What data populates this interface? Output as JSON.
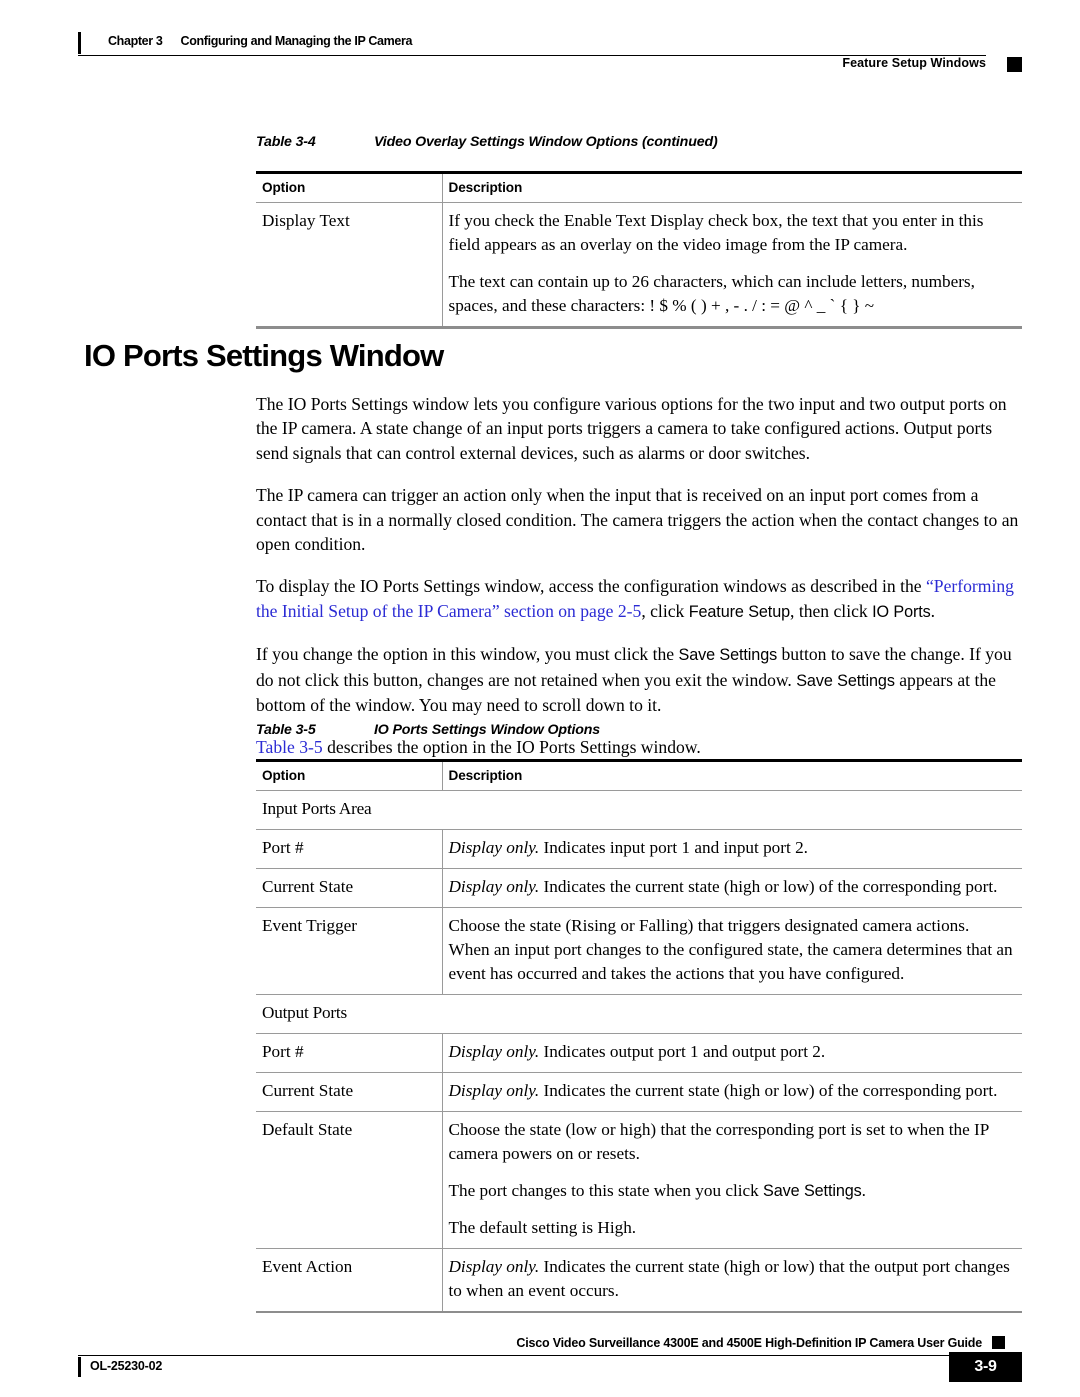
{
  "header": {
    "chapter_number": "Chapter 3",
    "chapter_title": "Configuring and Managing the IP Camera",
    "right_label": "Feature Setup Windows"
  },
  "footer": {
    "guide_title": "Cisco Video Surveillance 4300E and 4500E High-Definition IP Camera User Guide",
    "doc_id": "OL-25230-02",
    "page_number": "3-9"
  },
  "table_3_4": {
    "caption_number": "Table 3-4",
    "caption_title": "Video Overlay Settings Window Options (continued)",
    "columns": [
      "Option",
      "Description"
    ],
    "rows": [
      {
        "option": "Display Text",
        "paragraphs": [
          "If you check the Enable Text Display check box, the text that you enter in this field appears as an overlay on the video image from the IP camera.",
          "The text can contain up to 26 characters, which can include letters, numbers, spaces, and these characters: ! $ % ( ) + , - . / : = @ ^ _ ` { } ~"
        ]
      }
    ]
  },
  "section": {
    "heading": "IO Ports Settings Window",
    "paragraphs": {
      "p1": "The IO Ports Settings window lets you configure various options for the two input and two output ports on the IP camera. A state change of an input ports triggers a camera to take configured actions. Output ports send signals that can control external devices, such as alarms or door switches.",
      "p2": "The IP camera can trigger an action only when the input that is received on an input port comes from a contact that is in a normally closed condition. The camera triggers the action when the contact changes to an open condition.",
      "p3_part1": "To display the IO Ports Settings window, access the configuration windows as described in the ",
      "p3_link": "“Performing the Initial Setup of the IP Camera” section on page 2-5",
      "p3_part2": ", click ",
      "p3_ui1": "Feature Setup",
      "p3_part3": ", then click ",
      "p3_ui2": "IO Ports",
      "p3_part4": ".",
      "p4_part1": "If you change the option in this window, you must click the ",
      "p4_ui1": "Save Settings",
      "p4_part2": " button to save the change. If you do not click this button, changes are not retained when you exit the window. ",
      "p4_ui2": "Save Settings",
      "p4_part3": " appears at the bottom of the window. You may need to scroll down to it.",
      "p5_link": "Table 3-5",
      "p5_part1": " describes the option in the IO Ports Settings window."
    }
  },
  "table_3_5": {
    "caption_number": "Table 3-5",
    "caption_title": "IO Ports Settings Window Options",
    "columns": [
      "Option",
      "Description"
    ],
    "section_input": "Input Ports Area",
    "section_output": "Output Ports",
    "rows_input": [
      {
        "option": "Port #",
        "paragraphs": [
          {
            "em": "Display only.",
            "rest": " Indicates input port 1 and input port 2."
          }
        ]
      },
      {
        "option": "Current State",
        "paragraphs": [
          {
            "em": "Display only.",
            "rest": " Indicates the current state (high or low) of the corresponding port."
          }
        ]
      },
      {
        "option": "Event Trigger",
        "paragraphs": [
          {
            "em": "",
            "rest": "Choose the state (Rising or Falling) that triggers designated camera actions. When an input port changes to the configured state, the camera determines that an event has occurred and takes the actions that you have configured."
          }
        ]
      }
    ],
    "rows_output": [
      {
        "option": "Port #",
        "paragraphs": [
          {
            "em": "Display only.",
            "rest": " Indicates output port 1 and output port 2."
          }
        ]
      },
      {
        "option": "Current State",
        "paragraphs": [
          {
            "em": "Display only.",
            "rest": " Indicates the current state (high or low) of the corresponding port."
          }
        ]
      },
      {
        "option": "Default State",
        "paragraphs": [
          {
            "em": "",
            "rest": "Choose the state (low or high) that the corresponding port is set to when the IP camera powers on or resets."
          }
        ],
        "p2_part1": "The port changes to this state when you click ",
        "p2_ui": "Save Settings",
        "p2_part2": ".",
        "p3": "The default setting is High."
      },
      {
        "option": "Event Action",
        "paragraphs": [
          {
            "em": "Display only.",
            "rest": " Indicates the current state (high or low) that the output port changes to when an event occurs."
          }
        ]
      }
    ]
  },
  "colors": {
    "link": "#2b2bd4",
    "rule": "#9a9a9a",
    "text": "#000000"
  }
}
